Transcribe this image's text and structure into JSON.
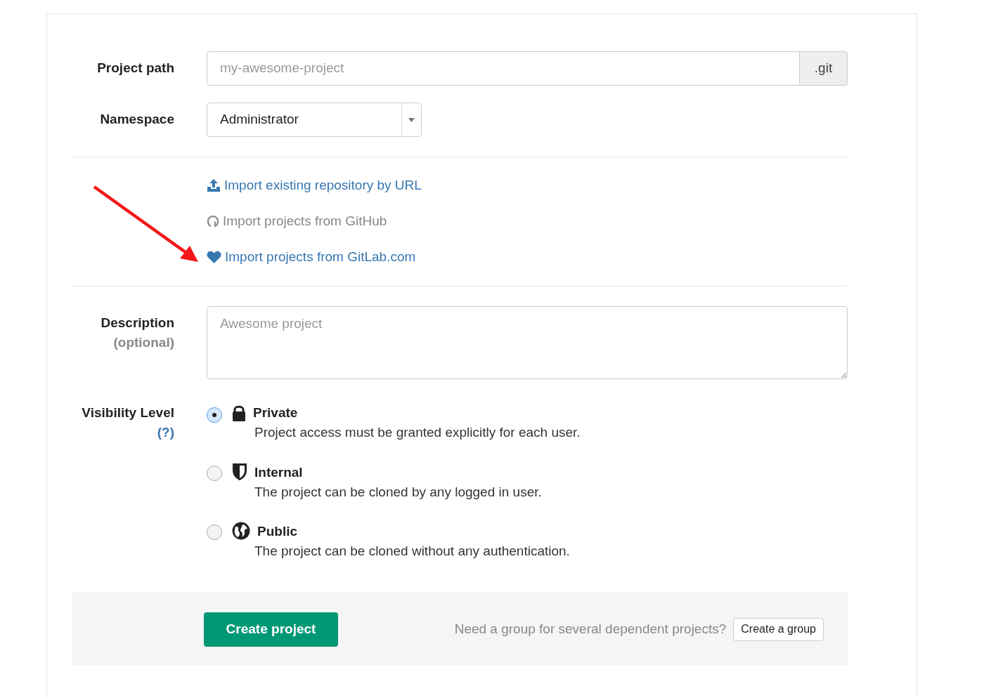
{
  "project_path": {
    "label": "Project path",
    "placeholder": "my-awesome-project",
    "addon": ".git"
  },
  "namespace": {
    "label": "Namespace",
    "value": "Administrator"
  },
  "imports": [
    {
      "kind": "upload",
      "label": "Import existing repository by URL",
      "disabled": false
    },
    {
      "kind": "github",
      "label": "Import projects from GitHub",
      "disabled": true
    },
    {
      "kind": "heart",
      "label": "Import projects from GitLab.com",
      "disabled": false
    }
  ],
  "description": {
    "label": "Description",
    "sublabel": "(optional)",
    "placeholder": "Awesome project"
  },
  "visibility": {
    "label": "Visibility Level",
    "help": "(?)",
    "options": [
      {
        "kind": "lock",
        "title": "Private",
        "text": "Project access must be granted explicitly for each user.",
        "selected": true
      },
      {
        "kind": "shield",
        "title": "Internal",
        "text": "The project can be cloned by any logged in user.",
        "selected": false
      },
      {
        "kind": "globe",
        "title": "Public",
        "text": "The project can be cloned without any authentication.",
        "selected": false
      }
    ]
  },
  "footer": {
    "submit": "Create project",
    "hint": "Need a group for several dependent projects?",
    "group_button": "Create a group"
  }
}
